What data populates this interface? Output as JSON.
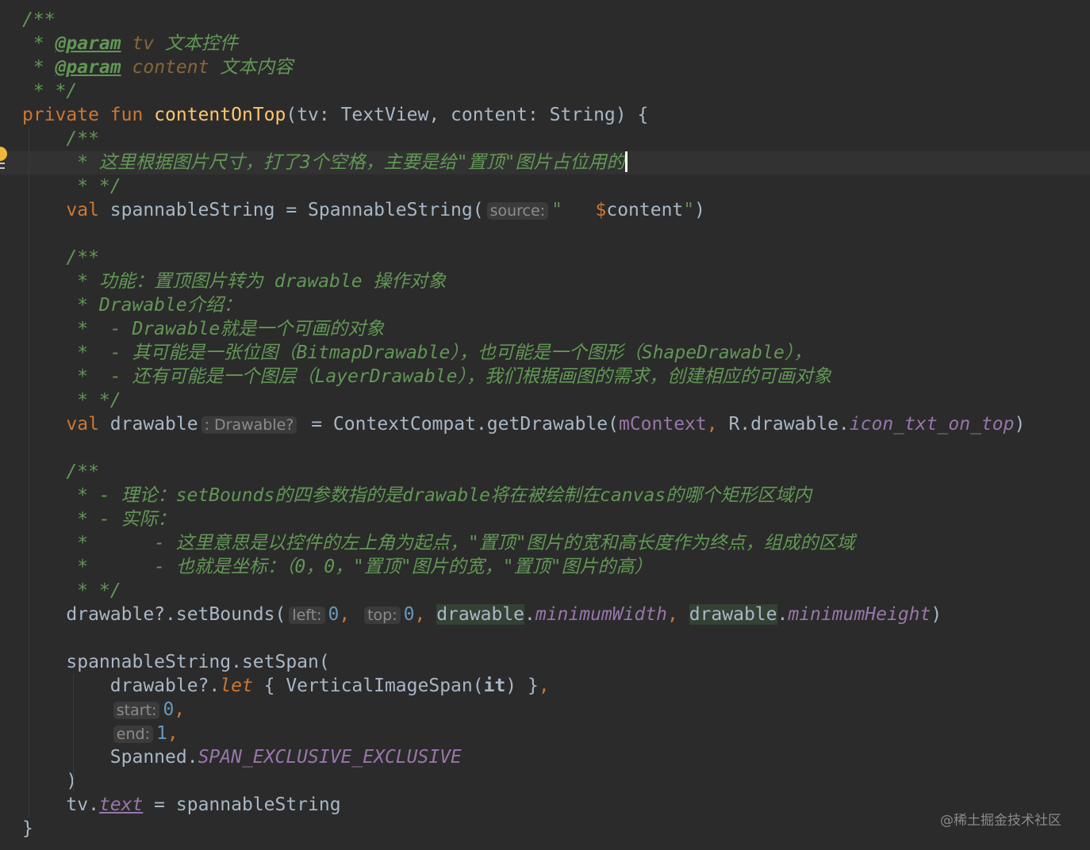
{
  "editor": {
    "current_line": 6,
    "lines": [
      {
        "tokens": [
          {
            "t": "/**",
            "c": "doc"
          }
        ]
      },
      {
        "tokens": [
          {
            "t": " * ",
            "c": "doc"
          },
          {
            "t": "@param",
            "c": "doctag"
          },
          {
            "t": " ",
            "c": "doc"
          },
          {
            "t": "tv",
            "c": "docparam"
          },
          {
            "t": " 文本控件",
            "c": "doc"
          }
        ]
      },
      {
        "tokens": [
          {
            "t": " * ",
            "c": "doc"
          },
          {
            "t": "@param",
            "c": "doctag"
          },
          {
            "t": " ",
            "c": "doc"
          },
          {
            "t": "content",
            "c": "docparam"
          },
          {
            "t": " 文本内容",
            "c": "doc"
          }
        ]
      },
      {
        "tokens": [
          {
            "t": " * */",
            "c": "doc"
          }
        ]
      },
      {
        "tokens": [
          {
            "t": "private fun ",
            "c": "kw"
          },
          {
            "t": "contentOnTop",
            "c": "fn"
          },
          {
            "t": "(tv: TextView, content: String) {",
            "c": "plain"
          }
        ]
      },
      {
        "tokens": [
          {
            "t": "    /**",
            "c": "doc"
          }
        ]
      },
      {
        "tokens": [
          {
            "t": "     * 这里根据图片尺寸，打了3个空格，主要是给\"置顶\"图片占位用的",
            "c": "doc"
          },
          {
            "t": "",
            "c": "caret"
          }
        ]
      },
      {
        "tokens": [
          {
            "t": "     * */",
            "c": "doc"
          }
        ]
      },
      {
        "tokens": [
          {
            "t": "    ",
            "c": "plain"
          },
          {
            "t": "val ",
            "c": "kw"
          },
          {
            "t": "spannableString = SpannableString(",
            "c": "plain"
          },
          {
            "t": "source:",
            "c": "hint"
          },
          {
            "t": "\"   ",
            "c": "str"
          },
          {
            "t": "$",
            "c": "tmpl"
          },
          {
            "t": "content",
            "c": "plain"
          },
          {
            "t": "\"",
            "c": "str"
          },
          {
            "t": ")",
            "c": "plain"
          }
        ]
      },
      {
        "tokens": []
      },
      {
        "tokens": [
          {
            "t": "    /**",
            "c": "doc"
          }
        ]
      },
      {
        "tokens": [
          {
            "t": "     * 功能：置顶图片转为 drawable 操作对象",
            "c": "doc"
          }
        ]
      },
      {
        "tokens": [
          {
            "t": "     * Drawable介绍：",
            "c": "doc"
          }
        ]
      },
      {
        "tokens": [
          {
            "t": "     *  - Drawable就是一个可画的对象",
            "c": "doc"
          }
        ]
      },
      {
        "tokens": [
          {
            "t": "     *  - 其可能是一张位图（BitmapDrawable），也可能是一个图形（ShapeDrawable），",
            "c": "doc"
          }
        ]
      },
      {
        "tokens": [
          {
            "t": "     *  - 还有可能是一个图层（LayerDrawable），我们根据画图的需求，创建相应的可画对象",
            "c": "doc"
          }
        ]
      },
      {
        "tokens": [
          {
            "t": "     * */",
            "c": "doc"
          }
        ]
      },
      {
        "tokens": [
          {
            "t": "    ",
            "c": "plain"
          },
          {
            "t": "val ",
            "c": "kw"
          },
          {
            "t": "drawable",
            "c": "plain"
          },
          {
            "t": ": Drawable?",
            "c": "hint"
          },
          {
            "t": " = ContextCompat.getDrawable(",
            "c": "plain"
          },
          {
            "t": "mContext",
            "c": "field"
          },
          {
            "t": ", ",
            "c": "kw"
          },
          {
            "t": "R.drawable.",
            "c": "plain"
          },
          {
            "t": "icon_txt_on_top",
            "c": "fieldi"
          },
          {
            "t": ")",
            "c": "plain"
          }
        ]
      },
      {
        "tokens": []
      },
      {
        "tokens": [
          {
            "t": "    /**",
            "c": "doc"
          }
        ]
      },
      {
        "tokens": [
          {
            "t": "     * - 理论：setBounds的四参数指的是drawable将在被绘制在canvas的哪个矩形区域内",
            "c": "doc"
          }
        ]
      },
      {
        "tokens": [
          {
            "t": "     * - 实际：",
            "c": "doc"
          }
        ]
      },
      {
        "tokens": [
          {
            "t": "     *      - 这里意思是以控件的左上角为起点，\"置顶\"图片的宽和高长度作为终点，组成的区域",
            "c": "doc"
          }
        ]
      },
      {
        "tokens": [
          {
            "t": "     *      - 也就是坐标：（0，0，\"置顶\"图片的宽，\"置顶\"图片的高）",
            "c": "doc"
          }
        ]
      },
      {
        "tokens": [
          {
            "t": "     * */",
            "c": "doc"
          }
        ]
      },
      {
        "tokens": [
          {
            "t": "    drawable?.setBounds(",
            "c": "plain"
          },
          {
            "t": "left:",
            "c": "hint"
          },
          {
            "t": "0",
            "c": "num"
          },
          {
            "t": ", ",
            "c": "kw"
          },
          {
            "t": "top:",
            "c": "hint"
          },
          {
            "t": "0",
            "c": "num"
          },
          {
            "t": ", ",
            "c": "kw"
          },
          {
            "t": "drawable",
            "c": "hl"
          },
          {
            "t": ".",
            "c": "plain"
          },
          {
            "t": "minimumWidth",
            "c": "fieldi"
          },
          {
            "t": ", ",
            "c": "kw"
          },
          {
            "t": "drawable",
            "c": "hl"
          },
          {
            "t": ".",
            "c": "plain"
          },
          {
            "t": "minimumHeight",
            "c": "fieldi"
          },
          {
            "t": ")",
            "c": "plain"
          }
        ]
      },
      {
        "tokens": []
      },
      {
        "tokens": [
          {
            "t": "    spannableString.setSpan(",
            "c": "plain"
          }
        ]
      },
      {
        "tokens": [
          {
            "t": "        drawable?.",
            "c": "plain"
          },
          {
            "t": "let",
            "c": "kwi"
          },
          {
            "t": " { VerticalImageSpan(",
            "c": "plain"
          },
          {
            "t": "it",
            "c": "bold"
          },
          {
            "t": ") }",
            "c": "plain"
          },
          {
            "t": ",",
            "c": "kw"
          }
        ]
      },
      {
        "tokens": [
          {
            "t": "        ",
            "c": "plain"
          },
          {
            "t": "start:",
            "c": "hint"
          },
          {
            "t": "0",
            "c": "num"
          },
          {
            "t": ",",
            "c": "kw"
          }
        ]
      },
      {
        "tokens": [
          {
            "t": "        ",
            "c": "plain"
          },
          {
            "t": "end:",
            "c": "hint"
          },
          {
            "t": "1",
            "c": "num"
          },
          {
            "t": ",",
            "c": "kw"
          }
        ]
      },
      {
        "tokens": [
          {
            "t": "        Spanned.",
            "c": "plain"
          },
          {
            "t": "SPAN_EXCLUSIVE_EXCLUSIVE",
            "c": "fieldi"
          }
        ]
      },
      {
        "tokens": [
          {
            "t": "    )",
            "c": "plain"
          }
        ]
      },
      {
        "tokens": [
          {
            "t": "    tv.",
            "c": "plain"
          },
          {
            "t": "text",
            "c": "propu"
          },
          {
            "t": " = spannableString",
            "c": "plain"
          }
        ]
      },
      {
        "tokens": [
          {
            "t": "}",
            "c": "plain"
          }
        ]
      }
    ]
  },
  "watermark": "@稀土掘金技术社区",
  "colors": {
    "background": "#2b2b2b",
    "current_line": "#323232",
    "comment": "#629755",
    "keyword": "#cc7832",
    "function": "#ffc66d",
    "string": "#6a8759",
    "field": "#9876aa",
    "number": "#6897bb",
    "text": "#a9b7c6"
  },
  "icons": {
    "gutter": "lightbulb-icon"
  }
}
